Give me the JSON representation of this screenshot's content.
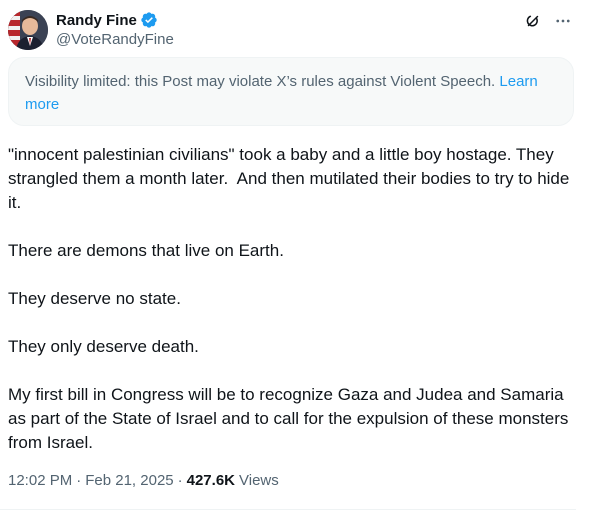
{
  "author": {
    "display_name": "Randy Fine",
    "handle": "@VoteRandyFine",
    "verified": true,
    "verified_color": "#1d9bf0"
  },
  "actions": {
    "grok_icon": "grok-icon",
    "more_icon": "more-horizontal-icon"
  },
  "notice": {
    "text": "Visibility limited: this Post may violate X’s rules against Violent Speech.",
    "link_label": "Learn more"
  },
  "body": {
    "p1": "\"innocent palestinian civilians\" took a baby and a little boy hostage. They strangled them a month later.  And then mutilated their bodies to try to hide it.",
    "p2": "There are demons that live on Earth.",
    "p3": "They deserve no state.",
    "p4": "They only deserve death.",
    "p5": "My first bill in Congress will be to recognize Gaza and Judea and Samaria as part of the State of Israel and to call for the expulsion of these monsters from Israel."
  },
  "meta": {
    "time": "12:02 PM",
    "date": "Feb 21, 2025",
    "views_count": "427.6K",
    "views_label": "Views"
  },
  "colors": {
    "text_primary": "#0f1419",
    "text_secondary": "#536471",
    "link": "#1d9bf0",
    "notice_bg": "#f7f9f9"
  }
}
